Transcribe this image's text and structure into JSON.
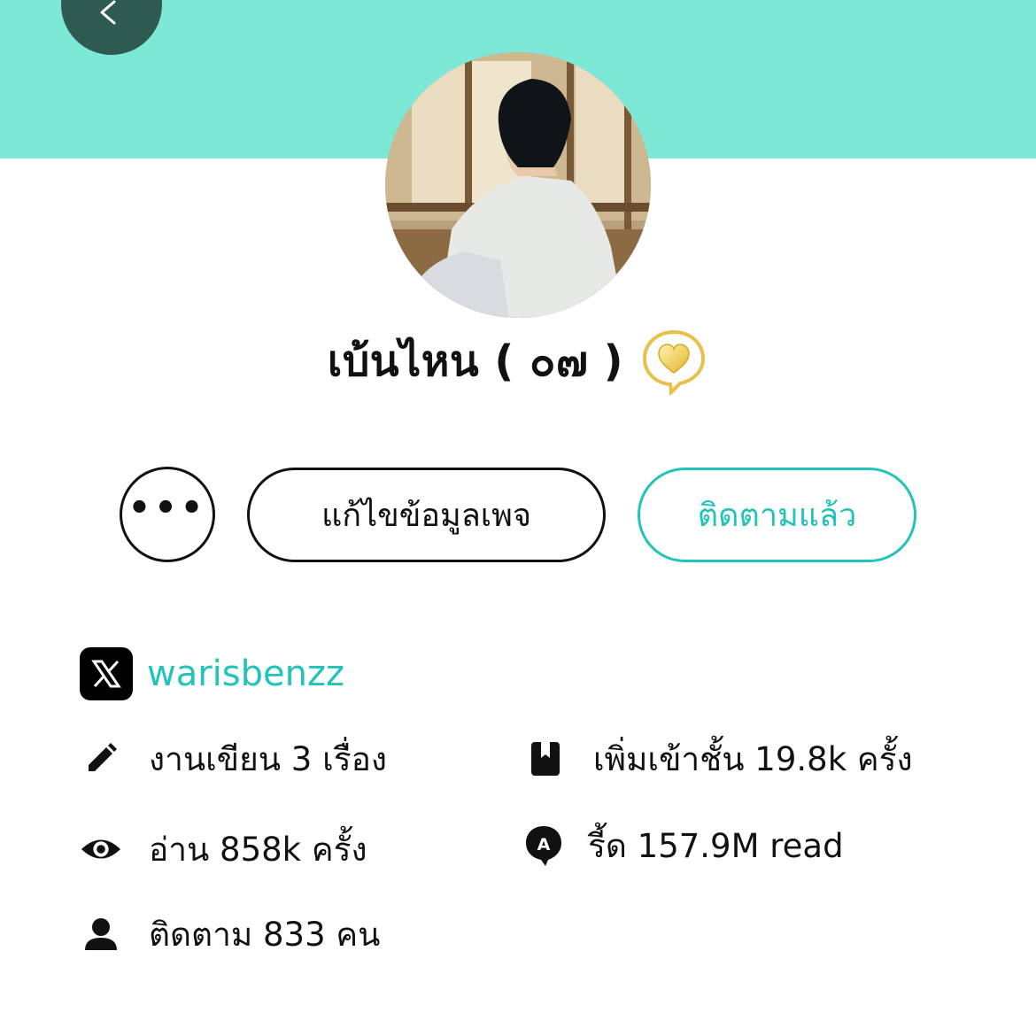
{
  "profile": {
    "display_name": "เบ้นไหน ( ๐๗ )",
    "badge_icon": "gold-heart-badge-icon"
  },
  "actions": {
    "more_label": "•••",
    "edit_label": "แก้ไขข้อมูลเพจ",
    "follow_label": "ติดตามแล้ว"
  },
  "social": {
    "platform_icon": "x-logo-icon",
    "handle": "warisbenzz"
  },
  "stats": {
    "works": "งานเขียน 3 เรื่อง",
    "shelf": "เพิ่มเข้าชั้น 19.8k ครั้ง",
    "views": "อ่าน 858k ครั้ง",
    "reads": "รี้ด 157.9M read",
    "followers": "ติดตาม 833 คน"
  },
  "colors": {
    "banner": "#7ee8d6",
    "accent": "#22c4b9",
    "back_button": "#2e5a52"
  }
}
